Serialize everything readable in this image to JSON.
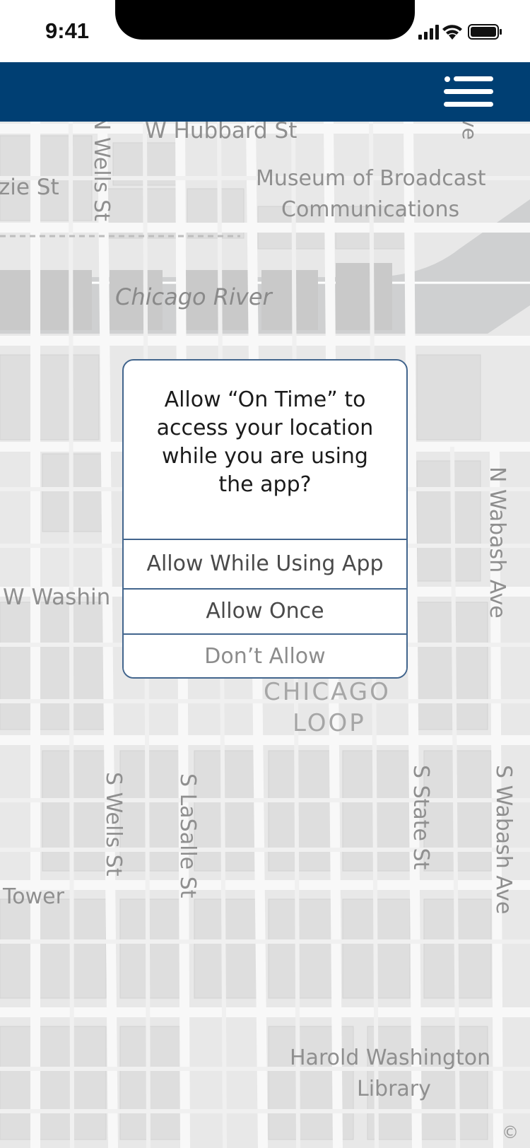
{
  "status_bar": {
    "time": "9:41"
  },
  "header": {
    "menu_icon": "hamburger-menu-icon",
    "background": "#003f73"
  },
  "map": {
    "labels": {
      "hubbard": "W Hubbard St",
      "kinzie": "zie St",
      "n_wells": "N Wells St",
      "museum_line1": "Museum of Broadcast",
      "museum_line2": "Communications",
      "river": "Chicago River",
      "n_wabash": "N Wabash Ave",
      "washington": "W Washin",
      "loop_line1": "CHICAGO",
      "loop_line2": "LOOP",
      "s_wells": "S Wells St",
      "s_lasalle": "S LaSalle St",
      "s_state": "S State St",
      "s_wabash": "S Wabash Ave",
      "tower": "Tower",
      "library_line1": "Harold Washington",
      "library_line2": "Library",
      "top_right": "ve"
    },
    "copyright": "©"
  },
  "dialog": {
    "message_lines": [
      "Allow “On Time” to",
      "access your location",
      "while you are using",
      "the app?"
    ],
    "allow_while_using": "Allow While Using App",
    "allow_once": "Allow Once",
    "dont_allow": "Don’t Allow",
    "border_color": "#42658d"
  }
}
